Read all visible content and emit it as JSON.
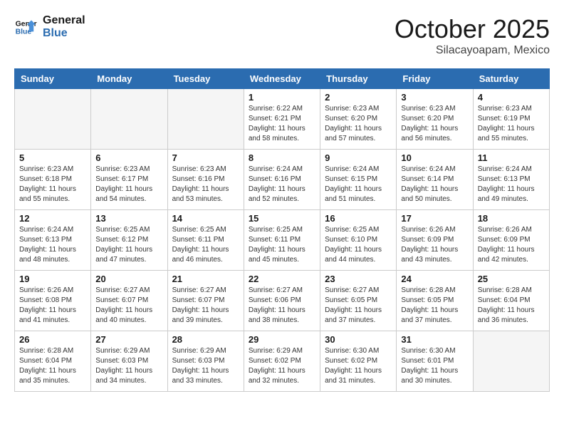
{
  "header": {
    "logo_line1": "General",
    "logo_line2": "Blue",
    "month": "October 2025",
    "location": "Silacayoapam, Mexico"
  },
  "weekdays": [
    "Sunday",
    "Monday",
    "Tuesday",
    "Wednesday",
    "Thursday",
    "Friday",
    "Saturday"
  ],
  "weeks": [
    [
      {
        "day": "",
        "info": ""
      },
      {
        "day": "",
        "info": ""
      },
      {
        "day": "",
        "info": ""
      },
      {
        "day": "1",
        "info": "Sunrise: 6:22 AM\nSunset: 6:21 PM\nDaylight: 11 hours and 58 minutes."
      },
      {
        "day": "2",
        "info": "Sunrise: 6:23 AM\nSunset: 6:20 PM\nDaylight: 11 hours and 57 minutes."
      },
      {
        "day": "3",
        "info": "Sunrise: 6:23 AM\nSunset: 6:20 PM\nDaylight: 11 hours and 56 minutes."
      },
      {
        "day": "4",
        "info": "Sunrise: 6:23 AM\nSunset: 6:19 PM\nDaylight: 11 hours and 55 minutes."
      }
    ],
    [
      {
        "day": "5",
        "info": "Sunrise: 6:23 AM\nSunset: 6:18 PM\nDaylight: 11 hours and 55 minutes."
      },
      {
        "day": "6",
        "info": "Sunrise: 6:23 AM\nSunset: 6:17 PM\nDaylight: 11 hours and 54 minutes."
      },
      {
        "day": "7",
        "info": "Sunrise: 6:23 AM\nSunset: 6:16 PM\nDaylight: 11 hours and 53 minutes."
      },
      {
        "day": "8",
        "info": "Sunrise: 6:24 AM\nSunset: 6:16 PM\nDaylight: 11 hours and 52 minutes."
      },
      {
        "day": "9",
        "info": "Sunrise: 6:24 AM\nSunset: 6:15 PM\nDaylight: 11 hours and 51 minutes."
      },
      {
        "day": "10",
        "info": "Sunrise: 6:24 AM\nSunset: 6:14 PM\nDaylight: 11 hours and 50 minutes."
      },
      {
        "day": "11",
        "info": "Sunrise: 6:24 AM\nSunset: 6:13 PM\nDaylight: 11 hours and 49 minutes."
      }
    ],
    [
      {
        "day": "12",
        "info": "Sunrise: 6:24 AM\nSunset: 6:13 PM\nDaylight: 11 hours and 48 minutes."
      },
      {
        "day": "13",
        "info": "Sunrise: 6:25 AM\nSunset: 6:12 PM\nDaylight: 11 hours and 47 minutes."
      },
      {
        "day": "14",
        "info": "Sunrise: 6:25 AM\nSunset: 6:11 PM\nDaylight: 11 hours and 46 minutes."
      },
      {
        "day": "15",
        "info": "Sunrise: 6:25 AM\nSunset: 6:11 PM\nDaylight: 11 hours and 45 minutes."
      },
      {
        "day": "16",
        "info": "Sunrise: 6:25 AM\nSunset: 6:10 PM\nDaylight: 11 hours and 44 minutes."
      },
      {
        "day": "17",
        "info": "Sunrise: 6:26 AM\nSunset: 6:09 PM\nDaylight: 11 hours and 43 minutes."
      },
      {
        "day": "18",
        "info": "Sunrise: 6:26 AM\nSunset: 6:09 PM\nDaylight: 11 hours and 42 minutes."
      }
    ],
    [
      {
        "day": "19",
        "info": "Sunrise: 6:26 AM\nSunset: 6:08 PM\nDaylight: 11 hours and 41 minutes."
      },
      {
        "day": "20",
        "info": "Sunrise: 6:27 AM\nSunset: 6:07 PM\nDaylight: 11 hours and 40 minutes."
      },
      {
        "day": "21",
        "info": "Sunrise: 6:27 AM\nSunset: 6:07 PM\nDaylight: 11 hours and 39 minutes."
      },
      {
        "day": "22",
        "info": "Sunrise: 6:27 AM\nSunset: 6:06 PM\nDaylight: 11 hours and 38 minutes."
      },
      {
        "day": "23",
        "info": "Sunrise: 6:27 AM\nSunset: 6:05 PM\nDaylight: 11 hours and 37 minutes."
      },
      {
        "day": "24",
        "info": "Sunrise: 6:28 AM\nSunset: 6:05 PM\nDaylight: 11 hours and 37 minutes."
      },
      {
        "day": "25",
        "info": "Sunrise: 6:28 AM\nSunset: 6:04 PM\nDaylight: 11 hours and 36 minutes."
      }
    ],
    [
      {
        "day": "26",
        "info": "Sunrise: 6:28 AM\nSunset: 6:04 PM\nDaylight: 11 hours and 35 minutes."
      },
      {
        "day": "27",
        "info": "Sunrise: 6:29 AM\nSunset: 6:03 PM\nDaylight: 11 hours and 34 minutes."
      },
      {
        "day": "28",
        "info": "Sunrise: 6:29 AM\nSunset: 6:03 PM\nDaylight: 11 hours and 33 minutes."
      },
      {
        "day": "29",
        "info": "Sunrise: 6:29 AM\nSunset: 6:02 PM\nDaylight: 11 hours and 32 minutes."
      },
      {
        "day": "30",
        "info": "Sunrise: 6:30 AM\nSunset: 6:02 PM\nDaylight: 11 hours and 31 minutes."
      },
      {
        "day": "31",
        "info": "Sunrise: 6:30 AM\nSunset: 6:01 PM\nDaylight: 11 hours and 30 minutes."
      },
      {
        "day": "",
        "info": ""
      }
    ]
  ]
}
